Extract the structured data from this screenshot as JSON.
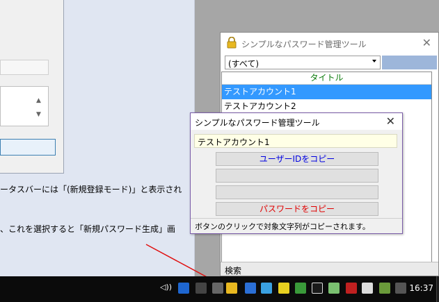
{
  "background": {
    "line1": "ータスバーには「(新規登録モード)」と表示され",
    "line2": "、これを選択すると「新規パスワード生成」画"
  },
  "main_window": {
    "title": "シンプルなパスワード管理ツール",
    "filter_value": "(すべて)",
    "list_header": "タイトル",
    "rows": [
      "テストアカウント1",
      "テストアカウント2"
    ],
    "status": "検索"
  },
  "popup": {
    "title": "シンプルなパスワード管理ツール",
    "account": "テストアカウント1",
    "btn_user": "ユーザーIDをコピー",
    "btn_password": "パスワードをコピー",
    "status": "ボタンのクリックで対象文字列がコピーされます。"
  },
  "taskbar": {
    "volume": "◁))",
    "clock": "16:37"
  },
  "colors": {
    "selection": "#3399ff",
    "header_text": "#0a7a0a",
    "user_button_text": "#0000e0",
    "password_button_text": "#e00000",
    "arrow": "#e01010"
  }
}
